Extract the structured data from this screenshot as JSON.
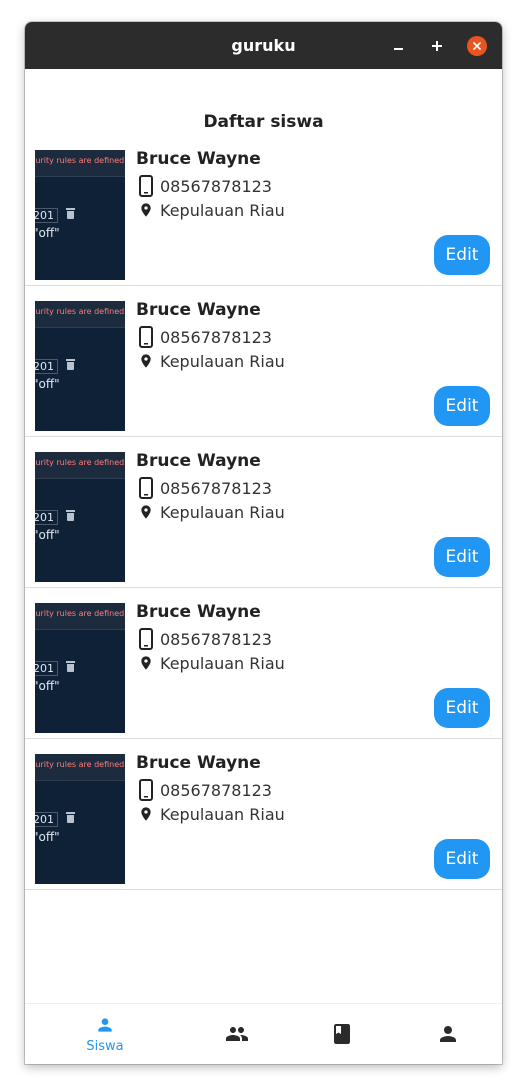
{
  "window": {
    "title": "guruku",
    "controls": [
      "minimize-icon",
      "maximize-icon",
      "close-icon"
    ],
    "close_color": "#e95420"
  },
  "page": {
    "title": "Daftar siswa"
  },
  "thumbnail": {
    "error_text": "curity rules are defined a",
    "value_text": "201",
    "off_text": "\"off\""
  },
  "students": [
    {
      "name": "Bruce Wayne",
      "phone": "08567878123",
      "location": "Kepulauan Riau",
      "edit_label": "Edit"
    },
    {
      "name": "Bruce Wayne",
      "phone": "08567878123",
      "location": "Kepulauan Riau",
      "edit_label": "Edit"
    },
    {
      "name": "Bruce Wayne",
      "phone": "08567878123",
      "location": "Kepulauan Riau",
      "edit_label": "Edit"
    },
    {
      "name": "Bruce Wayne",
      "phone": "08567878123",
      "location": "Kepulauan Riau",
      "edit_label": "Edit"
    },
    {
      "name": "Bruce Wayne",
      "phone": "08567878123",
      "location": "Kepulauan Riau",
      "edit_label": "Edit"
    }
  ],
  "bottom_nav": [
    {
      "icon": "person-icon",
      "label": "Siswa",
      "active": true
    },
    {
      "icon": "group-icon",
      "label": "",
      "active": false
    },
    {
      "icon": "book-icon",
      "label": "",
      "active": false
    },
    {
      "icon": "account-icon",
      "label": "",
      "active": false
    }
  ],
  "colors": {
    "accent": "#2196f3",
    "titlebar": "#2c2c2c",
    "icon_inactive": "#2b2b2b"
  }
}
